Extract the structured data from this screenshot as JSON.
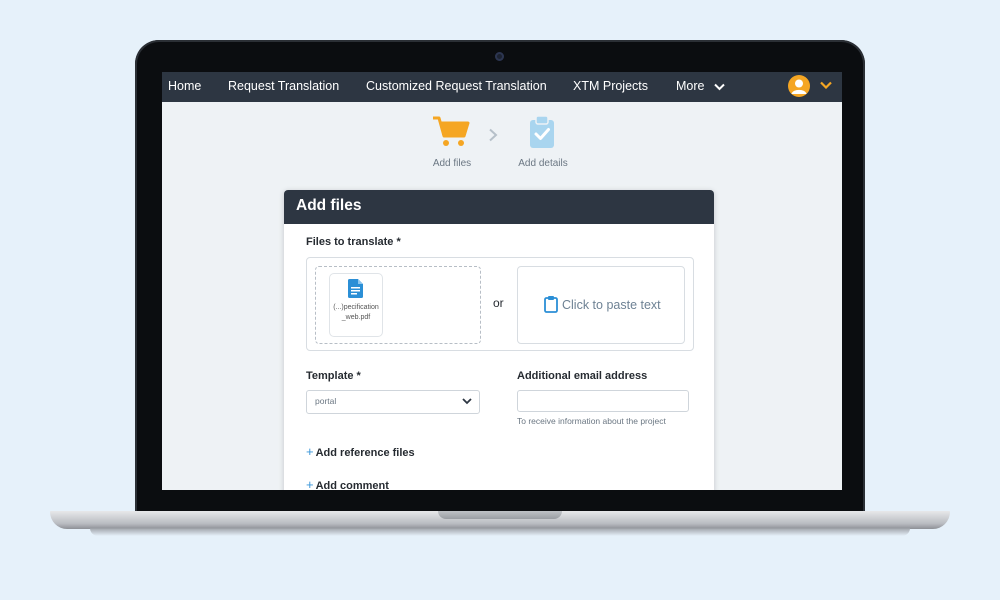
{
  "nav": {
    "items": [
      "Home",
      "Request Translation",
      "Customized Request Translation",
      "XTM Projects"
    ],
    "more_label": "More"
  },
  "steps": [
    {
      "label": "Add files",
      "icon": "cart-icon"
    },
    {
      "label": "Add details",
      "icon": "clipboard-check-icon"
    }
  ],
  "card": {
    "title": "Add files",
    "files_label": "Files to translate *",
    "file_name": "(...)pecification_web.pdf",
    "or_text": "or",
    "paste_label": "Click to paste text",
    "template_label": "Template *",
    "template_value": "portal",
    "email_label": "Additional email address",
    "email_value": "",
    "email_hint": "To receive information about the project",
    "add_reference": "Add reference files",
    "add_comment": "Add comment"
  },
  "colors": {
    "nav_bg": "#2d3642",
    "accent_orange": "#f5a623",
    "accent_blue": "#3a96d8",
    "page_bg": "#e6f1fa"
  }
}
